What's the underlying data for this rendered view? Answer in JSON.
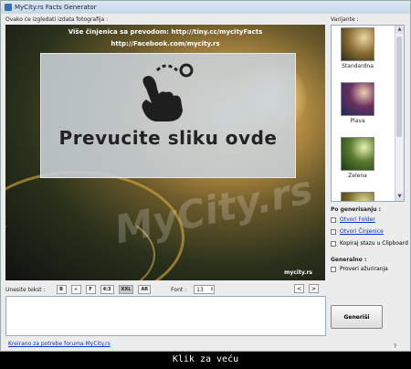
{
  "window": {
    "title": "MyCity.rs Facts Generator"
  },
  "preview": {
    "label": "Ovako će izgledati izdata fotografija :",
    "line1": "Više činjenica sa prevodom: http://tiny.cc/mycityFacts",
    "line2": "http://Facebook.com/mycity.rs",
    "drop_text": "Prevucite sliku ovde",
    "watermark": "MyCity.rs",
    "watermark_small": "mycity.rs"
  },
  "variants": {
    "label": "Varijante :",
    "items": [
      {
        "label": "Standardna"
      },
      {
        "label": "Plava"
      },
      {
        "label": "Zelena"
      }
    ],
    "scroll_up": "▲",
    "scroll_down": "▼"
  },
  "after_generate": {
    "title": "Po generisanju :",
    "options": [
      {
        "label": "Otvori Folder"
      },
      {
        "label": "Otvori Činjenice"
      },
      {
        "label": "Kopiraj stazu u Clipboard"
      }
    ]
  },
  "general": {
    "title": "Generalno :",
    "options": [
      {
        "label": "Proveri ažuriranja"
      }
    ]
  },
  "toolbar": {
    "label": "Unesite tekst :",
    "buttons": [
      "B",
      "«",
      "F",
      "4:3",
      "XXL",
      "AR"
    ],
    "font_label": "Font :",
    "font_value": "13",
    "font_spin": "⇕",
    "prev": "<",
    "next": ">"
  },
  "generate_label": "Generiši",
  "footer_link": "Kreirano za potrebe foruma MyCity.rs",
  "help": "?",
  "caption": "Klik za veću",
  "colors": {
    "link": "#0033cc",
    "title_bar": "#c7d6e6"
  }
}
